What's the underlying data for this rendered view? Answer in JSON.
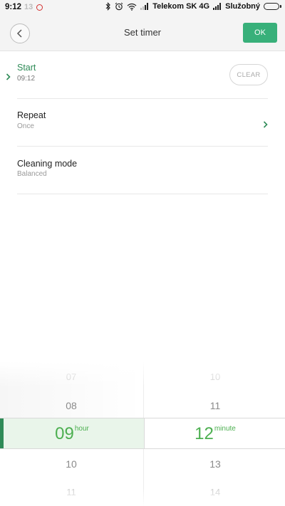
{
  "status_bar": {
    "time": "9:12",
    "faded_text": "13",
    "carrier": "Telekom SK 4G",
    "profile": "Služobný",
    "icons": [
      "bluetooth-icon",
      "alarm-icon",
      "wifi-icon",
      "signal-icon",
      "battery-icon"
    ]
  },
  "header": {
    "title": "Set timer",
    "ok_label": "OK",
    "accent_color": "#38b07a"
  },
  "settings": {
    "start": {
      "label": "Start",
      "value": "09:12",
      "clear_label": "CLEAR"
    },
    "repeat": {
      "label": "Repeat",
      "value": "Once"
    },
    "cleaning_mode": {
      "label": "Cleaning mode",
      "value": "Balanced"
    }
  },
  "picker": {
    "hour": {
      "above_far": "07",
      "above_near": "08",
      "selected": "09",
      "unit": "hour",
      "below_near": "10",
      "below_far": "11"
    },
    "minute": {
      "above_far": "10",
      "above_near": "11",
      "selected": "12",
      "unit": "minute",
      "below_near": "13",
      "below_far": "14"
    },
    "selected_color": "#4caf50"
  }
}
